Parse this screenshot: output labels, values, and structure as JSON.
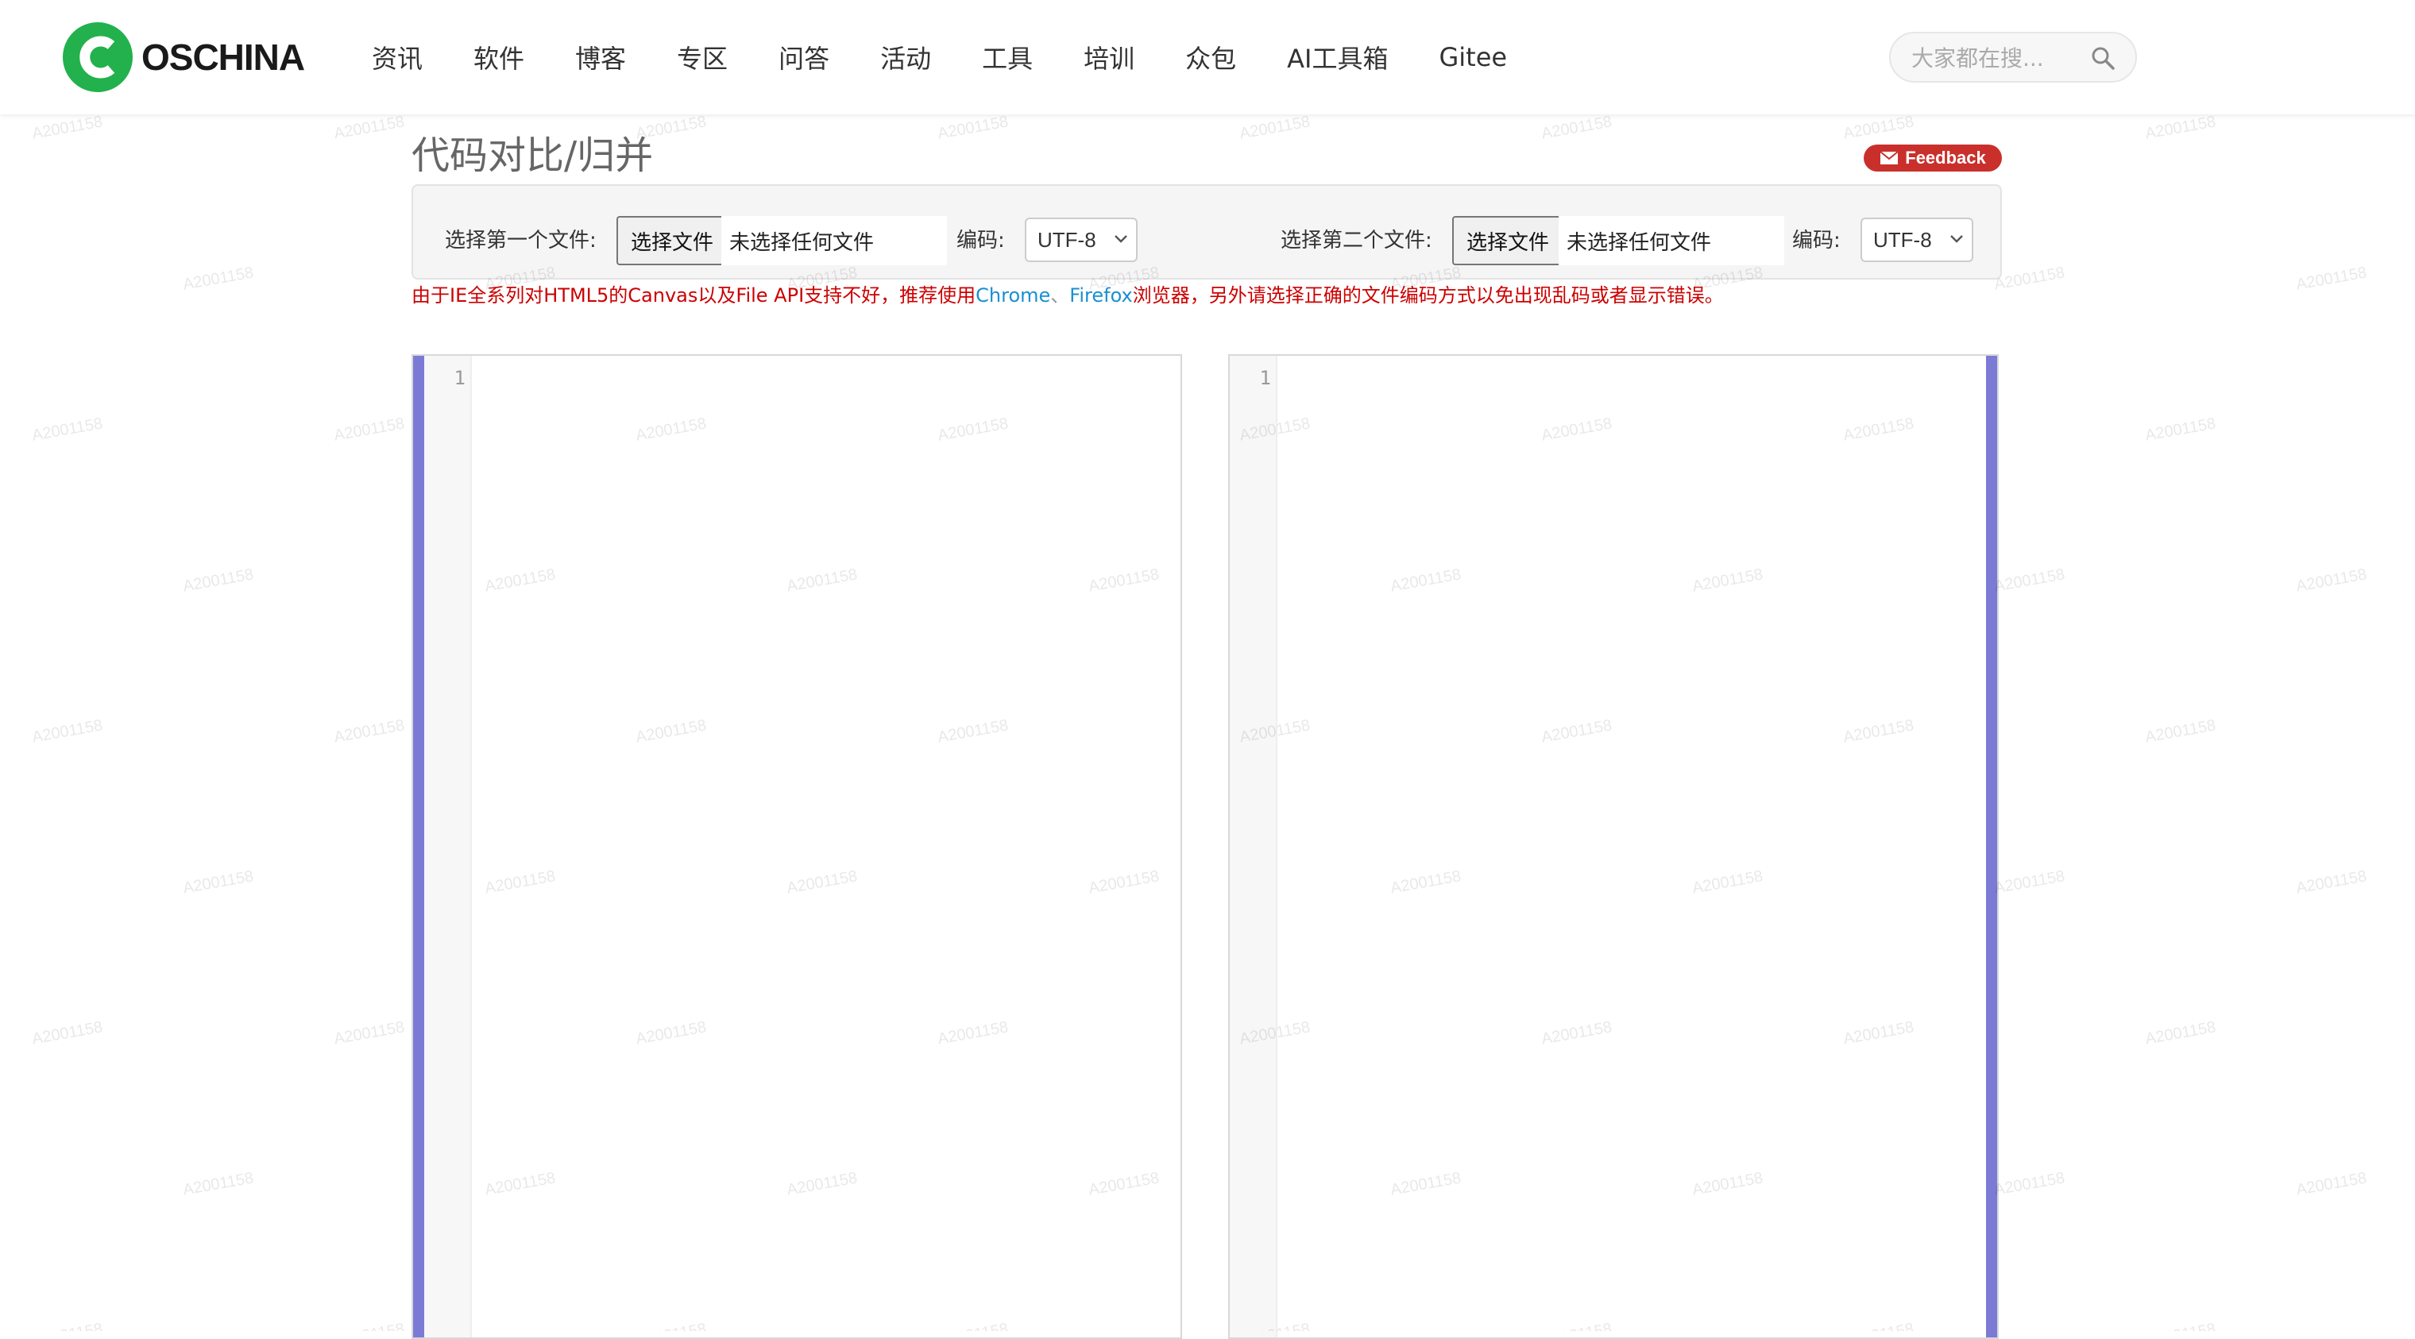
{
  "header": {
    "logo_text": "OSCHINA",
    "nav": [
      "资讯",
      "软件",
      "博客",
      "专区",
      "问答",
      "活动",
      "工具",
      "培训",
      "众包",
      "AI工具箱",
      "Gitee"
    ],
    "search_placeholder": "大家都在搜...",
    "search_icon": "magnifier-icon"
  },
  "page": {
    "title": "代码对比/归并",
    "feedback_label": "Feedback",
    "feedback_icon": "envelope-icon"
  },
  "toolbar": {
    "left": {
      "label": "选择第一个文件:",
      "button": "选择文件",
      "status": "未选择任何文件",
      "encoding_label": "编码:",
      "encoding_value": "UTF-8"
    },
    "right": {
      "label": "选择第二个文件:",
      "button": "选择文件",
      "status": "未选择任何文件",
      "encoding_label": "编码:",
      "encoding_value": "UTF-8"
    }
  },
  "notice": {
    "prefix": "由于IE全系列对HTML5的Canvas以及File API支持不好，推荐使用",
    "link1": "Chrome",
    "separator": "、",
    "link2": "Firefox",
    "suffix": "浏览器，另外请选择正确的文件编码方式以免出现乱码或者显示错误。"
  },
  "editors": {
    "left_line_number": "1",
    "right_line_number": "1"
  },
  "watermark": "A2001158",
  "colors": {
    "brand_green": "#22b14c",
    "feedback_red": "#c9302c",
    "notice_red": "#cc0000",
    "link_blue": "#1a8fd1",
    "editor_bar": "#7b7bd6"
  }
}
